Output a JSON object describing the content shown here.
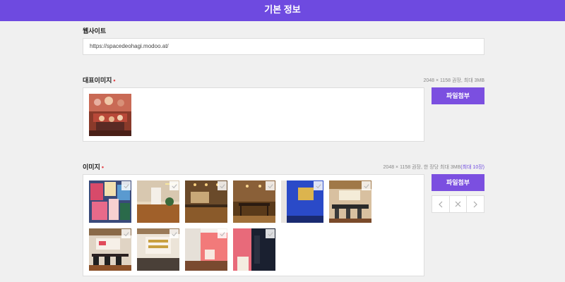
{
  "header": {
    "title": "기본 정보"
  },
  "website": {
    "label": "웹사이트",
    "value": "https://spacedeohagi.modoo.at/"
  },
  "main_image": {
    "label": "대표이미지",
    "required_mark": "•",
    "hint": "2048 × 1158 권장, 최대 3MB",
    "attach_label": "파일첨부"
  },
  "images": {
    "label": "이미지",
    "required_mark": "•",
    "hint": "2048 × 1158 권장, 한 장당 최대 3MB",
    "hint_limit": "(최대 10장)",
    "attach_label": "파일첨부",
    "nav": {
      "prev_icon": "chevron-left-icon",
      "delete_icon": "close-icon",
      "next_icon": "chevron-right-icon"
    },
    "thumbnails": [
      {
        "name": "gallery-thumb-1",
        "icon": "checkmark-icon"
      },
      {
        "name": "gallery-thumb-2",
        "icon": "checkmark-icon"
      },
      {
        "name": "gallery-thumb-3",
        "icon": "checkmark-icon"
      },
      {
        "name": "gallery-thumb-4",
        "icon": "checkmark-icon"
      },
      {
        "name": "gallery-thumb-5",
        "icon": "checkmark-icon"
      },
      {
        "name": "gallery-thumb-6",
        "icon": "checkmark-icon"
      },
      {
        "name": "gallery-thumb-7",
        "icon": "checkmark-icon"
      },
      {
        "name": "gallery-thumb-8",
        "icon": "checkmark-icon"
      },
      {
        "name": "gallery-thumb-9",
        "icon": "checkmark-icon"
      },
      {
        "name": "gallery-thumb-10",
        "icon": "checkmark-icon"
      }
    ]
  },
  "colors": {
    "accent": "#6e4ae0",
    "button": "#7b4fe0",
    "required": "#e5444a"
  }
}
